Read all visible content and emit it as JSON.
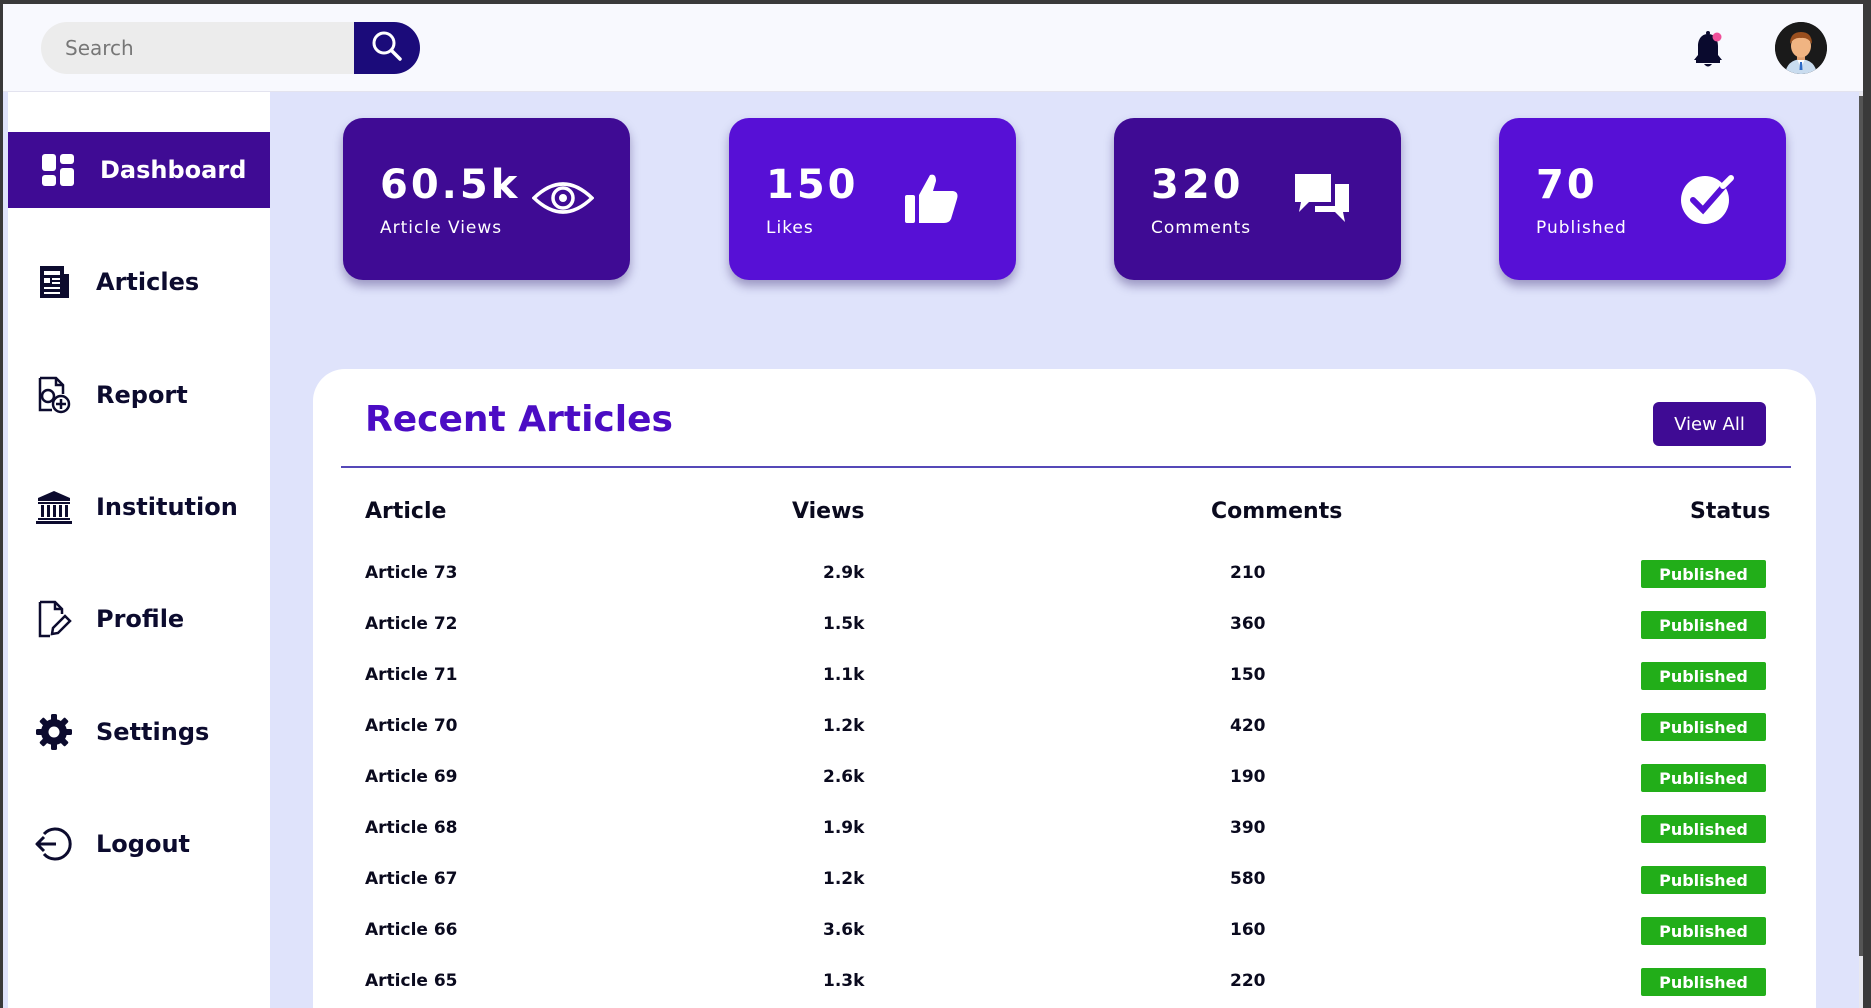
{
  "header": {
    "search_placeholder": "Search",
    "search_icon": "search-icon",
    "bell_icon": "bell-icon",
    "avatar_icon": "user-avatar"
  },
  "sidebar": {
    "items": [
      {
        "label": "Dashboard",
        "icon": "dashboard-icon",
        "active": true
      },
      {
        "label": "Articles",
        "icon": "articles-icon",
        "active": false
      },
      {
        "label": "Report",
        "icon": "report-icon",
        "active": false
      },
      {
        "label": "Institution",
        "icon": "institution-icon",
        "active": false
      },
      {
        "label": "Profile",
        "icon": "profile-icon",
        "active": false
      },
      {
        "label": "Settings",
        "icon": "gear-icon",
        "active": false
      },
      {
        "label": "Logout",
        "icon": "logout-icon",
        "active": false
      }
    ]
  },
  "stats": [
    {
      "value": "60.5k",
      "label": "Article Views",
      "icon": "eye-icon",
      "color": "#3f0b94"
    },
    {
      "value": "150",
      "label": "Likes",
      "icon": "thumbs-up-icon",
      "color": "#5710d6"
    },
    {
      "value": "320",
      "label": "Comments",
      "icon": "comments-icon",
      "color": "#3f0b94"
    },
    {
      "value": "70",
      "label": "Published",
      "icon": "check-circle-icon",
      "color": "#5710d6"
    }
  ],
  "recent": {
    "title": "Recent Articles",
    "view_all_label": "View All",
    "columns": [
      "Article",
      "Views",
      "Comments",
      "Status"
    ],
    "rows": [
      {
        "article": "Article 73",
        "views": "2.9k",
        "comments": "210",
        "status": "Published"
      },
      {
        "article": "Article 72",
        "views": "1.5k",
        "comments": "360",
        "status": "Published"
      },
      {
        "article": "Article 71",
        "views": "1.1k",
        "comments": "150",
        "status": "Published"
      },
      {
        "article": "Article 70",
        "views": "1.2k",
        "comments": "420",
        "status": "Published"
      },
      {
        "article": "Article 69",
        "views": "2.6k",
        "comments": "190",
        "status": "Published"
      },
      {
        "article": "Article 68",
        "views": "1.9k",
        "comments": "390",
        "status": "Published"
      },
      {
        "article": "Article 67",
        "views": "1.2k",
        "comments": "580",
        "status": "Published"
      },
      {
        "article": "Article 66",
        "views": "3.6k",
        "comments": "160",
        "status": "Published"
      },
      {
        "article": "Article 65",
        "views": "1.3k",
        "comments": "220",
        "status": "Published"
      }
    ]
  },
  "colors": {
    "primary_dark": "#3f0b94",
    "primary": "#5710d6",
    "title_purple": "#4b0cc4",
    "status_green": "#22ae19",
    "background": "#dfe3fb"
  }
}
